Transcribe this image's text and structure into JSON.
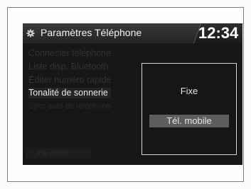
{
  "header": {
    "title": "Paramètres Téléphone",
    "clock": "12:34",
    "icon": "gear-icon"
  },
  "menu": {
    "items": [
      {
        "label": "Connecter téléphone"
      },
      {
        "label": "Liste disp. Bluetooth"
      },
      {
        "label": "Éditer numéro rapide"
      },
      {
        "label": "Tonalité de sonnerie",
        "selected": true
      },
      {
        "label": "Sync auto de téléphone"
      }
    ],
    "default_button": "Par défaut"
  },
  "popup": {
    "options": [
      {
        "label": "Fixe"
      },
      {
        "label": "Tél. mobile",
        "selected": true
      }
    ]
  }
}
